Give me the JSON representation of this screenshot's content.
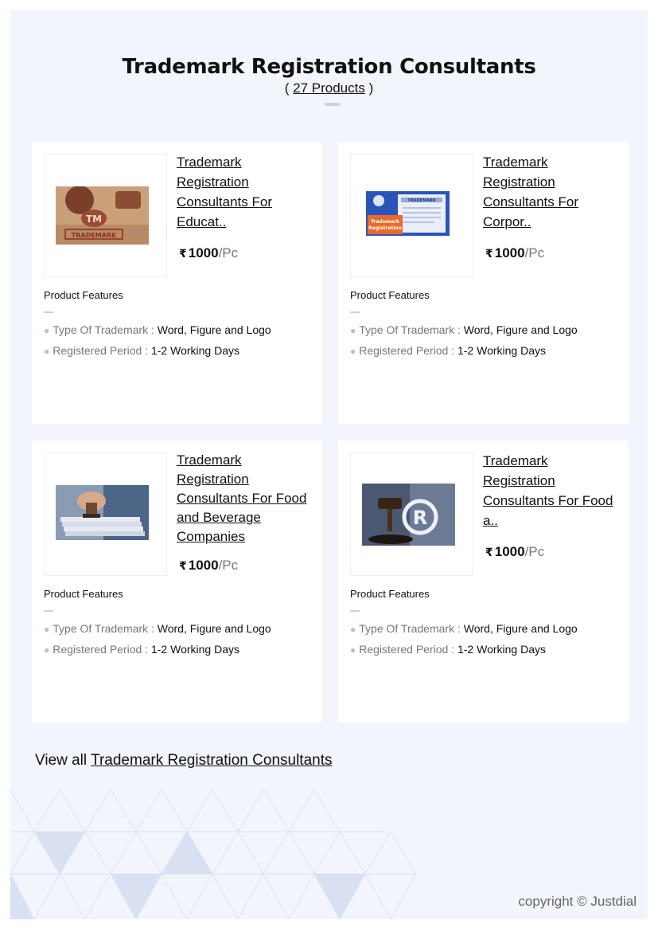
{
  "header": {
    "title": "Trademark Registration Consultants",
    "count_open": "( ",
    "count_link": "27 Products",
    "count_close": " )"
  },
  "products": [
    {
      "title": "Trademark Registration Consultants For Educat..",
      "currency": "₹",
      "price": "1000",
      "unit": "/Pc",
      "image_icon": "tm-stamp-image",
      "features_heading": "Product Features",
      "features": [
        {
          "label": "Type Of Trademark :",
          "value": "Word, Figure and Logo"
        },
        {
          "label": "Registered Period :",
          "value": "1-2 Working Days"
        }
      ]
    },
    {
      "title": "Trademark Registration Consultants For Corpor..",
      "currency": "₹",
      "price": "1000",
      "unit": "/Pc",
      "image_icon": "trademark-form-image",
      "features_heading": "Product Features",
      "features": [
        {
          "label": "Type Of Trademark :",
          "value": "Word, Figure and Logo"
        },
        {
          "label": "Registered Period :",
          "value": "1-2 Working Days"
        }
      ]
    },
    {
      "title": "Trademark Registration Consultants For Food and Beverage Companies",
      "currency": "₹",
      "price": "1000",
      "unit": "/Pc",
      "image_icon": "stamping-documents-image",
      "features_heading": "Product Features",
      "features": [
        {
          "label": "Type Of Trademark :",
          "value": "Word, Figure and Logo"
        },
        {
          "label": "Registered Period :",
          "value": "1-2 Working Days"
        }
      ]
    },
    {
      "title": "Trademark Registration Consultants For Food a..",
      "currency": "₹",
      "price": "1000",
      "unit": "/Pc",
      "image_icon": "gavel-registered-image",
      "features_heading": "Product Features",
      "features": [
        {
          "label": "Type Of Trademark :",
          "value": "Word, Figure and Logo"
        },
        {
          "label": "Registered Period :",
          "value": "1-2 Working Days"
        }
      ]
    }
  ],
  "footer": {
    "view_all_prefix": "View all ",
    "view_all_link": "Trademark Registration Consultants",
    "copyright": "copyright © Justdial"
  },
  "colors": {
    "background": "#f2f5fb",
    "card": "#ffffff",
    "accent_line": "#c9d1e8",
    "muted_text": "#777777"
  }
}
